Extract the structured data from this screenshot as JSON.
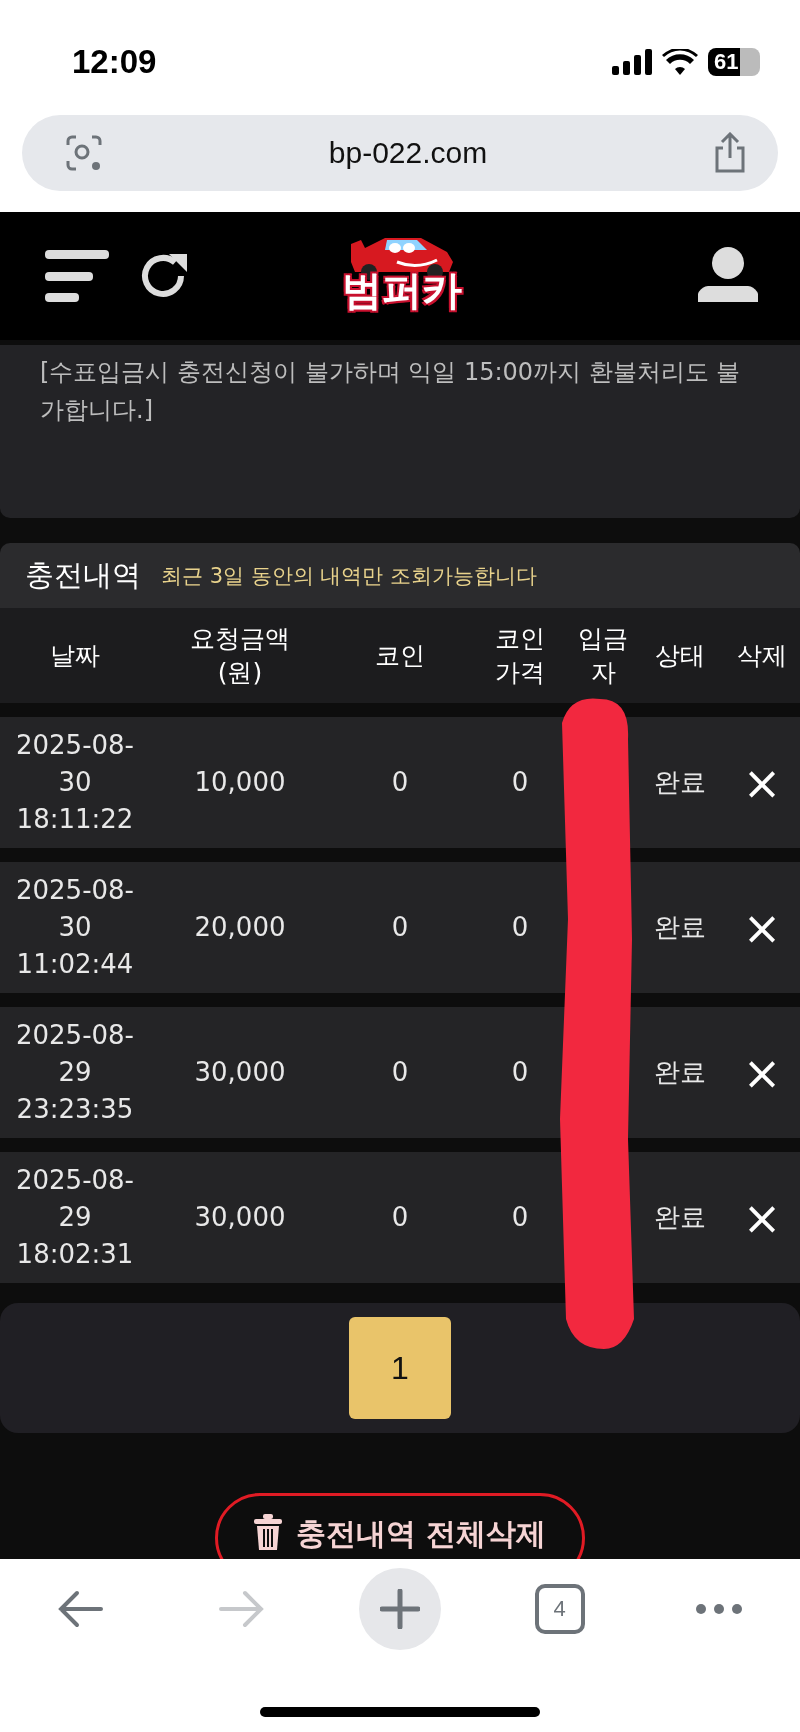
{
  "status_bar": {
    "time": "12:09",
    "battery": "61"
  },
  "address_bar": {
    "url": "bp-022.com"
  },
  "header": {
    "logo_text": "범퍼카"
  },
  "notice": {
    "text": "[수표입금시 충전신청이 불가하며 익일 15:00까지 환불처리도 불가합니다.]"
  },
  "history": {
    "title": "충전내역",
    "subtitle": "최근 3일 동안의 내역만 조회가능합니다",
    "columns": [
      "날짜",
      "요청금액\n(원)",
      "코인",
      "코인\n가격",
      "입금\n자",
      "상태",
      "삭제"
    ],
    "rows": [
      {
        "date": "2025-08-\n30\n18:11:22",
        "amount": "10,000",
        "coin": "0",
        "coin_price": "0",
        "status": "완료",
        "delete": "×"
      },
      {
        "date": "2025-08-\n30\n11:02:44",
        "amount": "20,000",
        "coin": "0",
        "coin_price": "0",
        "status": "완료",
        "delete": "×"
      },
      {
        "date": "2025-08-\n29\n23:23:35",
        "amount": "30,000",
        "coin": "0",
        "coin_price": "0",
        "status": "완료",
        "delete": "×"
      },
      {
        "date": "2025-08-\n29\n18:02:31",
        "amount": "30,000",
        "coin": "0",
        "coin_price": "0",
        "status": "완료",
        "delete": "×"
      }
    ]
  },
  "pagination": [
    {
      "label": "1",
      "selected": true
    }
  ],
  "delete_all_button": {
    "label": "충전내역 전체삭제"
  },
  "browser_toolbar": [
    {
      "kind": "back",
      "disabled": false
    },
    {
      "kind": "forward",
      "disabled": true
    },
    {
      "kind": "new_tab",
      "disabled": false
    },
    {
      "kind": "tabs",
      "label": "4",
      "disabled": false
    },
    {
      "kind": "more",
      "disabled": false
    }
  ]
}
